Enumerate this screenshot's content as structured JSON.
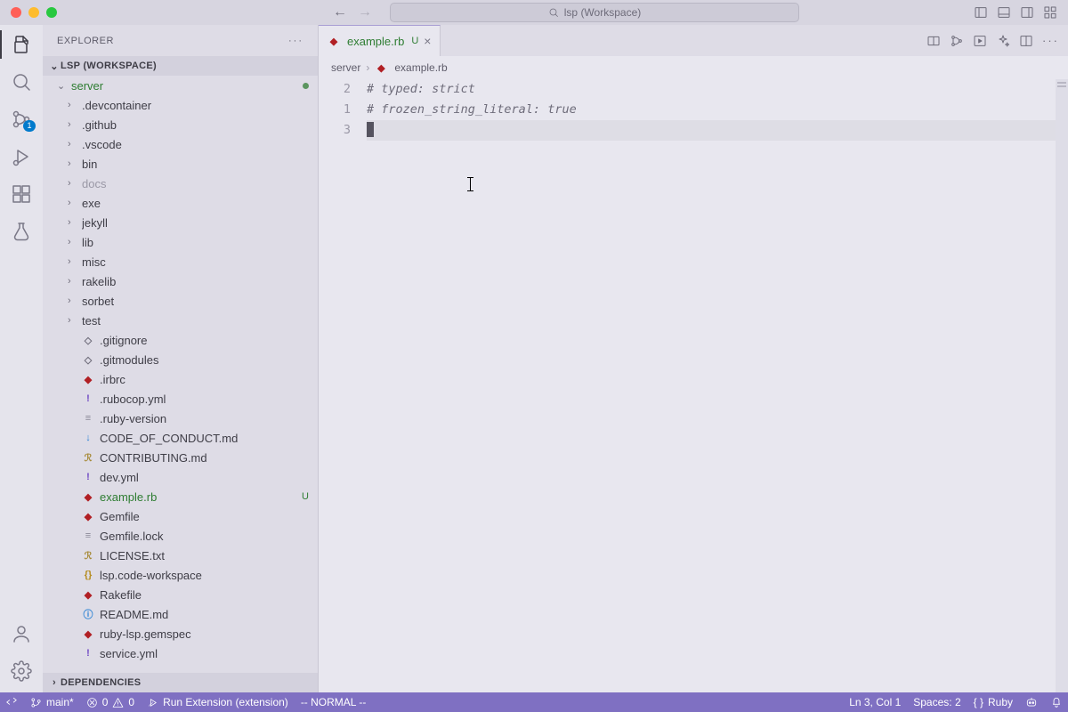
{
  "titlebar": {
    "search_label": "lsp (Workspace)"
  },
  "sidebar": {
    "title": "EXPLORER",
    "section_title": "LSP (WORKSPACE)",
    "dependencies_title": "DEPENDENCIES",
    "root_folder": "server",
    "scm_badge": "1",
    "folders": [
      ".devcontainer",
      ".github",
      ".vscode",
      "bin",
      "docs",
      "exe",
      "jekyll",
      "lib",
      "misc",
      "rakelib",
      "sorbet",
      "test"
    ],
    "files": [
      {
        "name": ".gitignore",
        "icon": "git"
      },
      {
        "name": ".gitmodules",
        "icon": "git"
      },
      {
        "name": ".irbrc",
        "icon": "ruby"
      },
      {
        "name": ".rubocop.yml",
        "icon": "yml"
      },
      {
        "name": ".ruby-version",
        "icon": "lock"
      },
      {
        "name": "CODE_OF_CONDUCT.md",
        "icon": "md"
      },
      {
        "name": "CONTRIBUTING.md",
        "icon": "txt"
      },
      {
        "name": "dev.yml",
        "icon": "yml"
      },
      {
        "name": "example.rb",
        "icon": "ruby",
        "status": "U",
        "green": true
      },
      {
        "name": "Gemfile",
        "icon": "ruby"
      },
      {
        "name": "Gemfile.lock",
        "icon": "lock"
      },
      {
        "name": "LICENSE.txt",
        "icon": "txt"
      },
      {
        "name": "lsp.code-workspace",
        "icon": "json"
      },
      {
        "name": "Rakefile",
        "icon": "ruby"
      },
      {
        "name": "README.md",
        "icon": "info"
      },
      {
        "name": "ruby-lsp.gemspec",
        "icon": "ruby"
      },
      {
        "name": "service.yml",
        "icon": "yml"
      }
    ]
  },
  "tabs": {
    "open": [
      {
        "label": "example.rb",
        "status": "U"
      }
    ]
  },
  "breadcrumb": {
    "parts": [
      "server",
      "example.rb"
    ]
  },
  "code": {
    "lines": [
      {
        "num": "2",
        "text": "# typed: strict"
      },
      {
        "num": "1",
        "text": "# frozen_string_literal: true"
      },
      {
        "num": "3",
        "text": ""
      }
    ]
  },
  "statusbar": {
    "branch": "main*",
    "errors": "0",
    "warnings": "0",
    "run_task": "Run Extension (extension)",
    "vim_mode": "-- NORMAL --",
    "position": "Ln 3, Col 1",
    "spaces": "Spaces: 2",
    "lang": "Ruby"
  }
}
